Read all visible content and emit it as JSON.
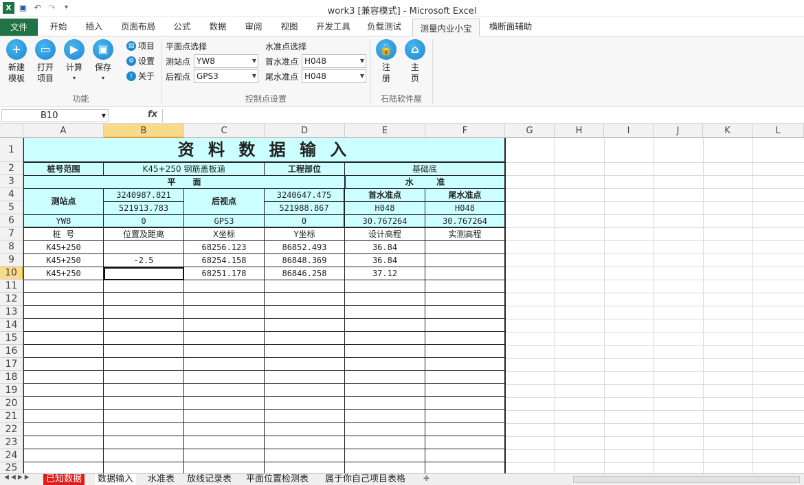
{
  "window": {
    "title": "work3  [兼容模式]  -  Microsoft Excel"
  },
  "ribbon_tabs": [
    "文件",
    "开始",
    "插入",
    "页面布局",
    "公式",
    "数据",
    "审阅",
    "视图",
    "开发工具",
    "负载测试",
    "测量内业小宝",
    "横断面辅助"
  ],
  "ribbon": {
    "buttons": [
      {
        "line1": "新建",
        "line2": "模板",
        "icon": "plus-icon"
      },
      {
        "line1": "打开",
        "line2": "项目",
        "icon": "folder-icon"
      },
      {
        "line1": "计算",
        "line2": "",
        "icon": "play-icon"
      },
      {
        "line1": "保存",
        "line2": "",
        "icon": "save-icon"
      }
    ],
    "small": [
      "项目",
      "设置",
      "关于"
    ],
    "group1": "功能",
    "plane_title": "平面点选择",
    "station_label": "测站点",
    "station_value": "YW8",
    "backsight_label": "后视点",
    "backsight_value": "GPS3",
    "level_title": "水准点选择",
    "first_label": "首水准点",
    "first_value": "H048",
    "last_label": "尾水准点",
    "last_value": "H048",
    "group2": "控制点设置",
    "reg1": "注",
    "reg2": "册",
    "home1": "主",
    "home2": "页",
    "group3": "石陆软件屋"
  },
  "namebox": "B10",
  "fx": "fx",
  "columns": [
    "A",
    "B",
    "C",
    "D",
    "E",
    "F",
    "G",
    "H",
    "I",
    "J",
    "K",
    "L"
  ],
  "rows": [
    "1",
    "2",
    "3",
    "4",
    "5",
    "6",
    "7",
    "8",
    "9",
    "10",
    "11",
    "12",
    "13",
    "14",
    "15",
    "16",
    "17",
    "18",
    "19",
    "20",
    "21",
    "22",
    "23",
    "24",
    "25"
  ],
  "sheet": {
    "title": "资 料 数 据 输 入",
    "r2": {
      "a": "桩号范围",
      "bc": "K45+250 钢筋盖板涵",
      "d": "工程部位",
      "ef": "基础底"
    },
    "r3": {
      "ad": "平      面",
      "ef": "水        准"
    },
    "r4": {
      "a": "测站点",
      "b": "3240987.821",
      "c": "后视点",
      "d": "3240647.475",
      "e": "首水准点",
      "f": "尾水准点"
    },
    "r5": {
      "b": "521913.783",
      "d": "521988.867",
      "e": "H048",
      "f": "H048"
    },
    "r6": {
      "a": "YW8",
      "b": "0",
      "c": "GPS3",
      "d": "0",
      "e": "30.767264",
      "f": "30.767264"
    },
    "r7": {
      "a": "桩  号",
      "b": "位置及距离",
      "c": "X坐标",
      "d": "Y坐标",
      "e": "设计高程",
      "f": "实测高程"
    },
    "data": [
      {
        "a": "K45+250",
        "b": "",
        "c": "68256.123",
        "d": "86852.493",
        "e": "36.84",
        "f": ""
      },
      {
        "a": "K45+250",
        "b": "-2.5",
        "c": "68254.158",
        "d": "86848.369",
        "e": "36.84",
        "f": ""
      },
      {
        "a": "K45+250",
        "b": "",
        "c": "68251.178",
        "d": "86846.258",
        "e": "37.12",
        "f": ""
      }
    ]
  },
  "sheet_tabs": [
    "已知数据",
    "数据输入",
    "水准表",
    "放线记录表",
    "平面位置检测表",
    "属于你自己项目表格"
  ]
}
